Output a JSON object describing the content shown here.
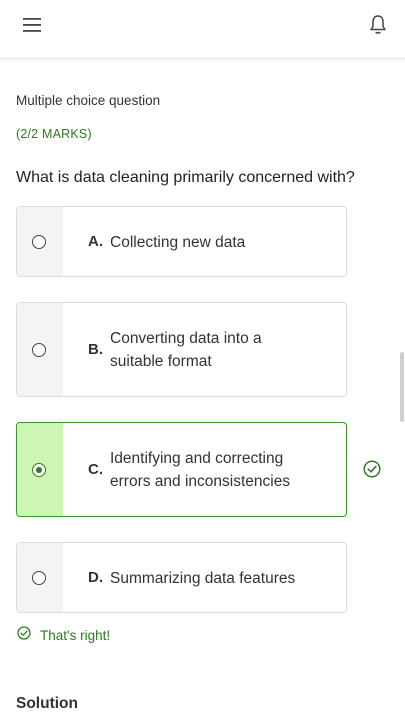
{
  "header": {
    "menu_icon": "hamburger-menu-icon",
    "notification_icon": "bell-icon"
  },
  "question": {
    "type_label": "Multiple choice question",
    "marks": "(2/2 MARKS)",
    "text": "What is data cleaning primarily concerned with?"
  },
  "options": [
    {
      "letter": "A.",
      "line1": "Collecting new data",
      "line2": "",
      "selected": false
    },
    {
      "letter": "B.",
      "line1": "Converting data into a",
      "line2": "suitable format",
      "selected": false
    },
    {
      "letter": "C.",
      "line1": "Identifying and correcting",
      "line2": "errors and inconsistencies",
      "selected": true
    },
    {
      "letter": "D.",
      "line1": "Summarizing data features",
      "line2": "",
      "selected": false
    }
  ],
  "feedback": {
    "text": "That's right!",
    "icon": "check-circle-icon",
    "color": "#2d7a1f"
  },
  "solution_heading": "Solution",
  "colors": {
    "correct_green": "#3c8f2a",
    "selected_fill": "#cdf5b3"
  }
}
